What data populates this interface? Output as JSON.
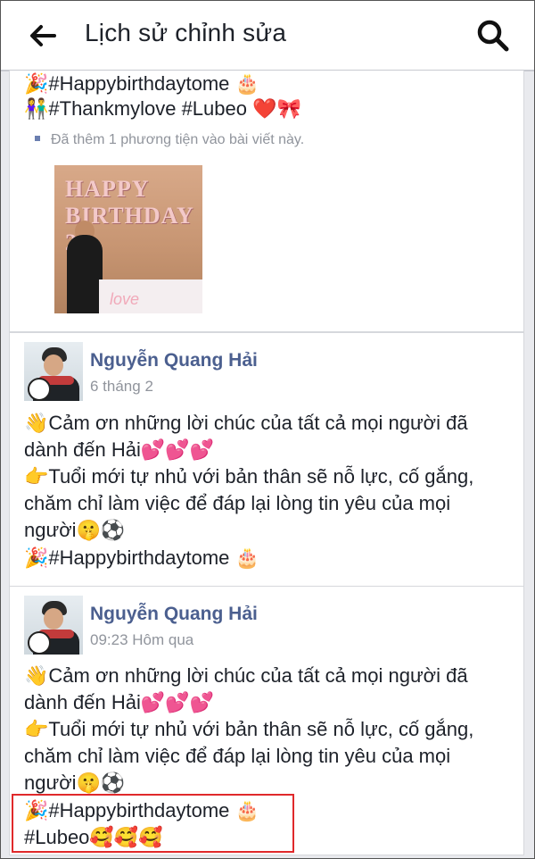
{
  "header": {
    "title": "Lịch sử chỉnh sửa",
    "back_icon": "arrow-left-icon",
    "search_icon": "search-icon"
  },
  "revisions": [
    {
      "lines": [
        "🎉#Happybirthdaytome 🎂",
        "👫#Thankmylove #Lubeo ❤️🎀"
      ],
      "media_note": "Đã thêm 1 phương tiện vào bài viết này.",
      "photo_text": "HAPPY BIRTHDAY 21",
      "photo_caption": "love"
    },
    {
      "author": "Nguyễn Quang Hải",
      "time": "6 tháng 2",
      "lines": [
        "👋Cảm ơn những lời chúc của tất cả mọi người đã",
        "dành đến Hải💕💕💕",
        "👉Tuổi mới tự nhủ với bản thân sẽ nỗ lực, cố gắng,",
        "chăm chỉ làm việc để đáp lại lòng tin yêu của mọi",
        "người🤫⚽",
        "🎉#Happybirthdaytome 🎂"
      ]
    },
    {
      "author": "Nguyễn Quang Hải",
      "time": "09:23 Hôm qua",
      "lines": [
        "👋Cảm ơn những lời chúc của tất cả mọi người đã",
        "dành đến Hải💕💕💕",
        "👉Tuổi mới tự nhủ với bản thân sẽ nỗ lực, cố gắng,",
        "chăm chỉ làm việc để đáp lại lòng tin yêu của mọi",
        "người🤫⚽",
        "🎉#Happybirthdaytome 🎂",
        "#Lubeo🥰🥰🥰"
      ]
    }
  ],
  "colors": {
    "accent_name": "#4b5f8f",
    "highlight_border": "#e0292b",
    "background": "#e9eaee"
  }
}
